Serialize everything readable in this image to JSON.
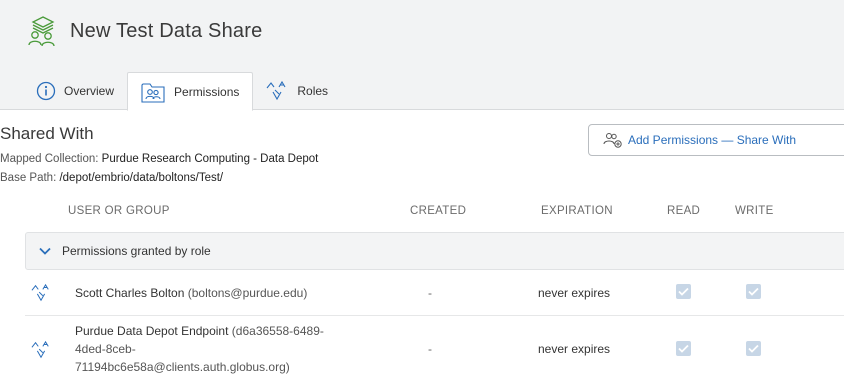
{
  "header": {
    "title": "New Test Data Share",
    "title_icon": "collection-share-icon"
  },
  "tabs": [
    {
      "label": "Overview",
      "icon": "info-circle-icon",
      "active": false
    },
    {
      "label": "Permissions",
      "icon": "users-folder-icon",
      "active": true
    },
    {
      "label": "Roles",
      "icon": "roles-icon",
      "active": false
    }
  ],
  "shared": {
    "title": "Shared With",
    "mapped_label": "Mapped Collection:",
    "mapped_value": "Purdue Research Computing - Data Depot",
    "base_label": "Base Path:",
    "base_value": "/depot/embrio/data/boltons/Test/",
    "add_button": "Add Permissions — Share With"
  },
  "table": {
    "headers": {
      "user": "USER OR GROUP",
      "created": "CREATED",
      "expiration": "EXPIRATION",
      "read": "READ",
      "write": "WRITE"
    },
    "group_label": "Permissions granted by role",
    "group_expanded": true,
    "rows": [
      {
        "name": "Scott Charles Bolton",
        "detail": "(boltons@purdue.edu)",
        "created": "-",
        "expiration": "never expires",
        "read": true,
        "write": true
      },
      {
        "name_line1": "Purdue Data Depot Endpoint",
        "detail_line1": "(d6a36558-6489-",
        "line2": "4ded-8ceb-",
        "line3": "71194bc6e58a@clients.auth.globus.org)",
        "created": "-",
        "expiration": "never expires",
        "read": true,
        "write": true
      }
    ]
  },
  "colors": {
    "accent": "#2a6ebb",
    "checkbox_disabled": "#c7d6e6",
    "header_bg": "#f2f3f4"
  }
}
